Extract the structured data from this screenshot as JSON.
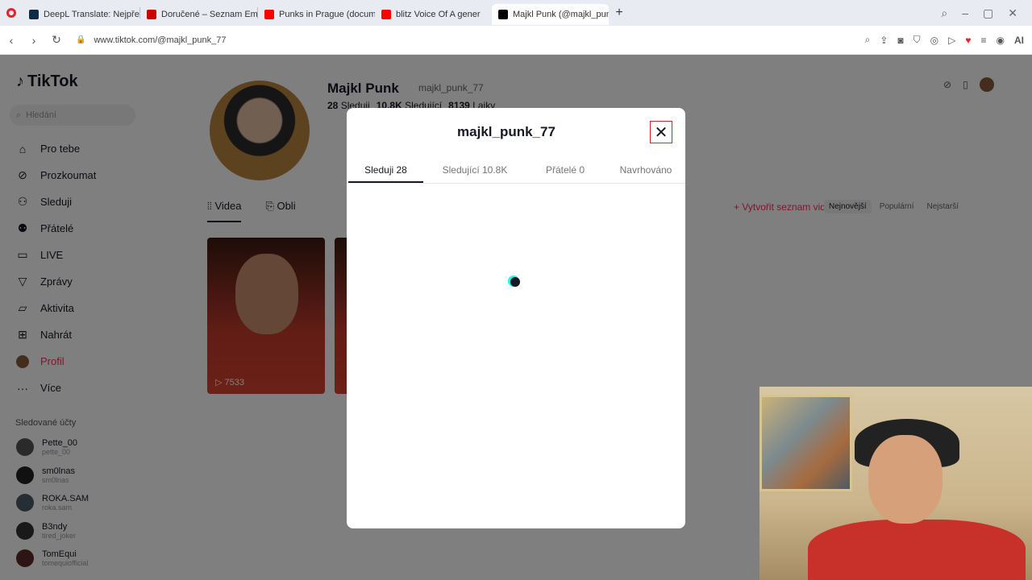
{
  "browser": {
    "tabs": [
      {
        "label": "DeepL Translate: Nejpřesn",
        "color": "#0f2b46",
        "active": false
      },
      {
        "label": "Doručené – Seznam Email",
        "color": "#cc0000",
        "active": false
      },
      {
        "label": "Punks in Prague (documer",
        "color": "#ff0000",
        "active": false
      },
      {
        "label": "blitz Voice Of A gener",
        "color": "#ff0000",
        "active": false
      },
      {
        "label": "Majkl Punk (@majkl_punk",
        "color": "#000000",
        "active": true
      }
    ],
    "new_tab": "+",
    "url": "www.tiktok.com/@majkl_punk_77"
  },
  "sidebar": {
    "logo": "TikTok",
    "search_placeholder": "Hledání",
    "items": [
      {
        "label": "Pro tebe",
        "icon": "home-icon"
      },
      {
        "label": "Prozkoumat",
        "icon": "compass-icon"
      },
      {
        "label": "Sleduji",
        "icon": "person-icon"
      },
      {
        "label": "Přátelé",
        "icon": "friends-icon"
      },
      {
        "label": "LIVE",
        "icon": "live-icon"
      },
      {
        "label": "Zprávy",
        "icon": "send-icon"
      },
      {
        "label": "Aktivita",
        "icon": "activity-icon"
      },
      {
        "label": "Nahrát",
        "icon": "plus-square-icon"
      },
      {
        "label": "Profil",
        "icon": "avatar"
      },
      {
        "label": "Více",
        "icon": "more-icon"
      }
    ],
    "following_title": "Sledované účty",
    "accounts": [
      {
        "name": "Pette_00",
        "user": "pette_00"
      },
      {
        "name": "sm0lnas",
        "user": "sm0lnas"
      },
      {
        "name": "ROKA.SAM",
        "user": "roka.sam"
      },
      {
        "name": "B3ndy",
        "user": "tired_joker"
      },
      {
        "name": "TomEqui",
        "user": "tomequiofficial"
      }
    ]
  },
  "profile": {
    "name": "Majkl Punk",
    "username": "majkl_punk_77",
    "following_count": "28",
    "following_label": "Sleduji",
    "followers_count": "10.8K",
    "followers_label": "Sledující",
    "likes_count": "8139",
    "likes_label": "Lajky",
    "tab_videos": "Videa",
    "tab_liked": "Obli",
    "create_list": "+ Vytvořit seznam videí",
    "sort": [
      "Nejnovější",
      "Populární",
      "Nejstarší"
    ],
    "video_views": "▷ 7533"
  },
  "modal": {
    "title": "majkl_punk_77",
    "close": "✕",
    "tabs": [
      {
        "label": "Sleduji 28",
        "active": true
      },
      {
        "label": "Sledující 10.8K",
        "active": false
      },
      {
        "label": "Přátelé 0",
        "active": false
      },
      {
        "label": "Navrhováno",
        "active": false
      }
    ]
  }
}
